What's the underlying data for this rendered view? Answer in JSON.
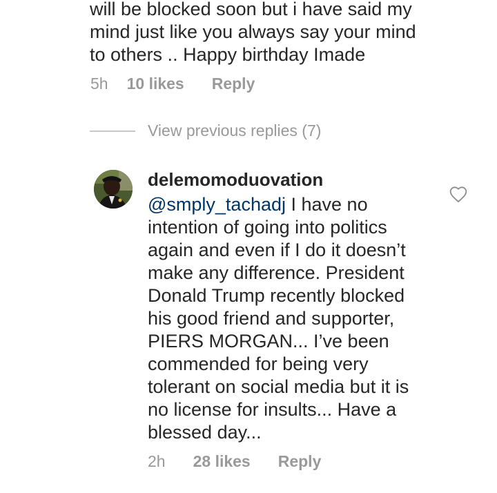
{
  "comment_1": {
    "text": "will be blocked soon but i have said my\nmind just like you always say your mind\nto others .. Happy birthday Imade",
    "time": "5h",
    "likes": "10 likes",
    "reply": "Reply"
  },
  "view_previous": {
    "label": "View previous replies (7)"
  },
  "comment_2": {
    "username": "delemomoduovation",
    "mention": "@smply_tachadj",
    "text": " I have no\nintention of going into politics\nagain and even if I do it doesn’t\nmake any difference. President\nDonald Trump recently blocked\nhis good friend and supporter,\nPIERS MORGAN... I’ve been\ncommended for being very\ntolerant on social media but it is\nno license for insults... Have a\nblessed day...",
    "time": "2h",
    "likes": "28 likes",
    "reply": "Reply",
    "like_icon": "heart-outline-icon"
  },
  "colors": {
    "text": "#262626",
    "muted": "#999999",
    "mention": "#003569",
    "divider": "#c7c7c7"
  }
}
